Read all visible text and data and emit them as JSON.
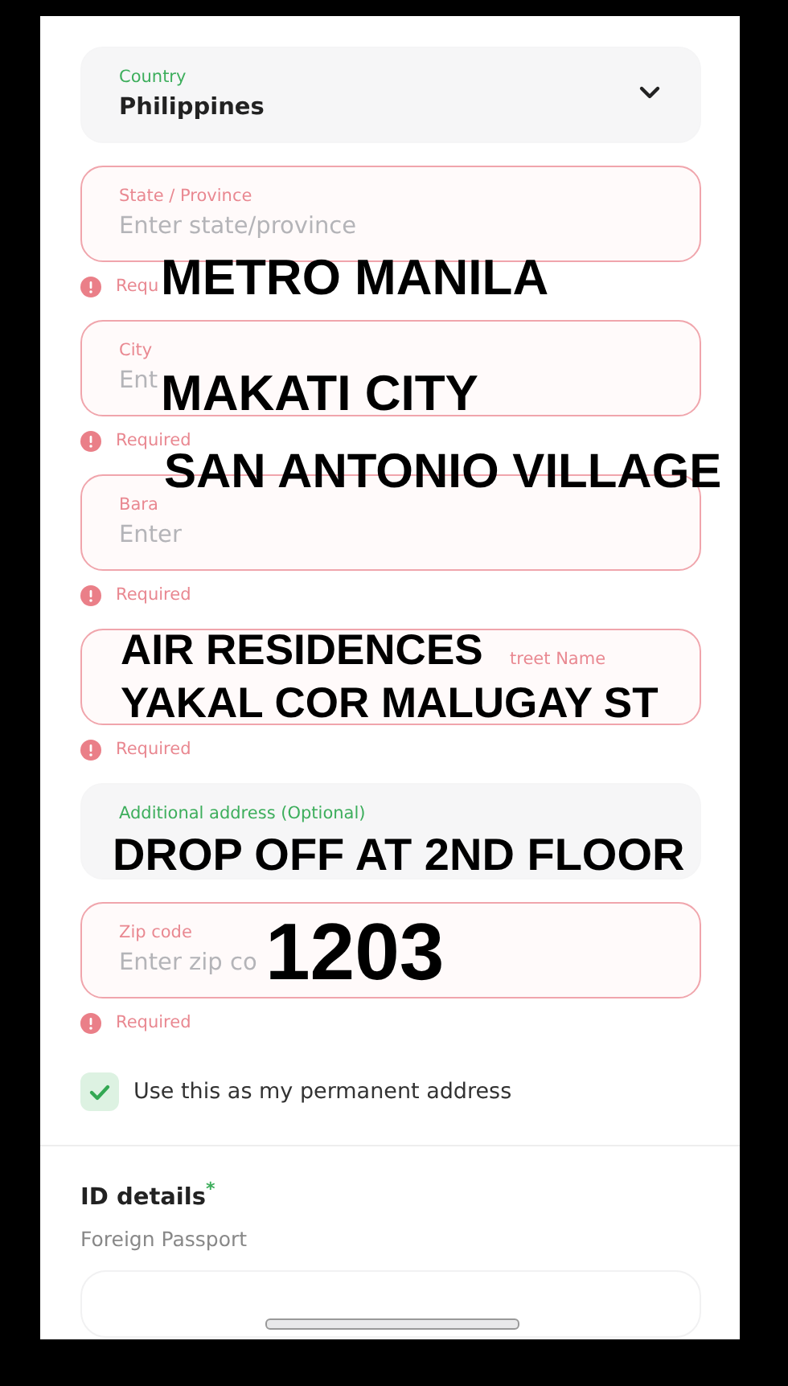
{
  "fields": [
    {
      "kind": "select",
      "label": "Country",
      "value": "Philippines",
      "error": false
    },
    {
      "kind": "text",
      "label": "State / Province",
      "placeholder": "Enter state/province",
      "error": true,
      "error_text": "Requ",
      "overlay": [
        "METRO MANILA"
      ]
    },
    {
      "kind": "text",
      "label": "City",
      "placeholder": "Ent",
      "error": true,
      "error_text": "Required",
      "overlay": [
        "MAKATI CITY"
      ]
    },
    {
      "kind": "text",
      "label": "Bara",
      "placeholder": "Enter",
      "error": true,
      "error_text": "Required",
      "overlay": [
        "SAN ANTONIO VILLAGE"
      ]
    },
    {
      "kind": "text",
      "label": "treet Name",
      "error": true,
      "error_text": "Required",
      "overlay": [
        "AIR RESIDENCES",
        "YAKAL COR MALUGAY ST"
      ]
    },
    {
      "kind": "text",
      "label": "Additional address (Optional)",
      "error": false,
      "overlay": [
        "DROP OFF AT 2ND FLOOR"
      ]
    },
    {
      "kind": "text",
      "label": "Zip code",
      "placeholder": "Enter zip co",
      "error": true,
      "error_text": "Required",
      "overlay": [
        "1203"
      ]
    }
  ],
  "permanent_address": {
    "label": "Use this as my permanent address",
    "checked": true
  },
  "id_details": {
    "title": "ID details",
    "required_mark": "*",
    "document_type": "Foreign Passport"
  }
}
